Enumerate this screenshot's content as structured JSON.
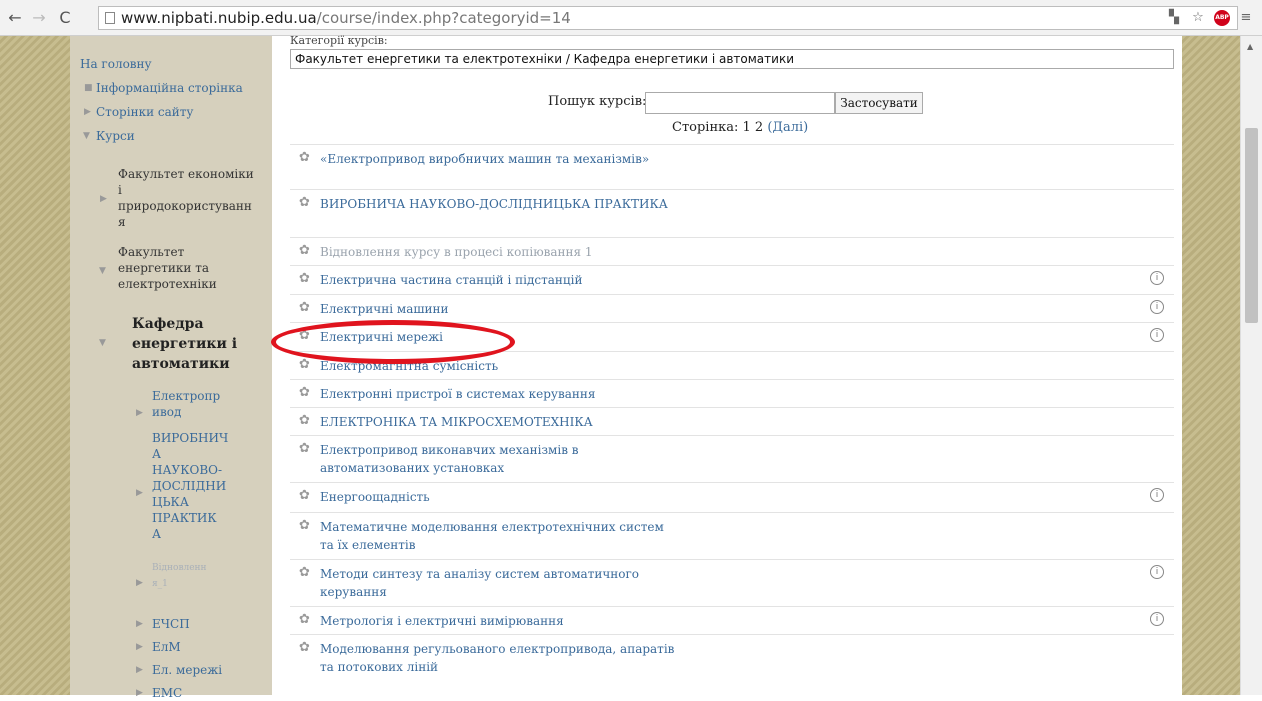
{
  "browser": {
    "url_host": "www.nipbati.nubip.edu.ua",
    "url_path": "/course/index.php?categoryid=14",
    "abp_label": "ABP"
  },
  "sidebar": {
    "home": "На головну",
    "items": [
      {
        "label": "Інформаційна сторінка"
      },
      {
        "label": "Сторінки сайту"
      },
      {
        "label": "Курси"
      }
    ],
    "fac_economics": [
      "Факультет економіки",
      "і",
      "природокористуванн",
      "я"
    ],
    "fac_energy": [
      "Факультет",
      "енергетики та",
      "електротехніки"
    ],
    "department": [
      "Кафедра",
      "енергетики і",
      "автоматики"
    ],
    "courses": {
      "c1": [
        "Електропр",
        "ивод"
      ],
      "c2": [
        "ВИРОБНИЧ",
        "А",
        "НАУКОВО-",
        "ДОСЛІДНИ",
        "ЦЬКА",
        "ПРАКТИК",
        "А"
      ],
      "c3": [
        "Відновленн",
        "я_1"
      ],
      "c4": "ЕЧСП",
      "c5": "ЕлМ",
      "c6": "Ел. мережі",
      "c7": "ЕМС"
    }
  },
  "main": {
    "category_label": "Категорії курсів:",
    "category_value": "Факультет енергетики та електротехніки / Кафедра енергетики і автоматики",
    "search_label": "Пошук курсів:",
    "search_value": "",
    "search_button": "Застосувати",
    "pages_text": "Сторінка: 1 2 ",
    "pages_next": "(Далі)",
    "courses": [
      {
        "name": "«Електропривод виробничих машин та механізмів»",
        "info": false
      },
      {
        "name": "ВИРОБНИЧА НАУКОВО-ДОСЛІДНИЦЬКА ПРАКТИКА",
        "info": false
      },
      {
        "name": "Відновлення курсу в процесі копіювання 1",
        "info": false
      },
      {
        "name": "Електрична частина станцій і підстанцій",
        "info": true
      },
      {
        "name": "Електричні машини",
        "info": true
      },
      {
        "name": "Електричні мережі",
        "info": true
      },
      {
        "name": "Електромагнітна сумісність",
        "info": false
      },
      {
        "name": "Електронні пристрої в системах керування",
        "info": false
      },
      {
        "name": "ЕЛЕКТРОНІКА ТА МІКРОСХЕМОТЕХНІКА",
        "info": false
      },
      {
        "name": "Електропривод виконавчих механізмів в автоматизованих установках",
        "info": false
      },
      {
        "name": "Енергоощадність",
        "info": true
      },
      {
        "name": "Математичне моделювання електротехнічних систем та їх елементів",
        "info": false
      },
      {
        "name": "Методи синтезу та аналізу систем автоматичного керування",
        "info": true
      },
      {
        "name": "Метрологія і електричні вимірювання",
        "info": true
      },
      {
        "name": "Моделювання регульованого електропривода, апаратів та потокових ліній",
        "info": false
      }
    ]
  },
  "colors": {
    "highlight": "#e0141e",
    "link": "#3a6a9a",
    "sidebar_bg": "#d6d0bd"
  }
}
